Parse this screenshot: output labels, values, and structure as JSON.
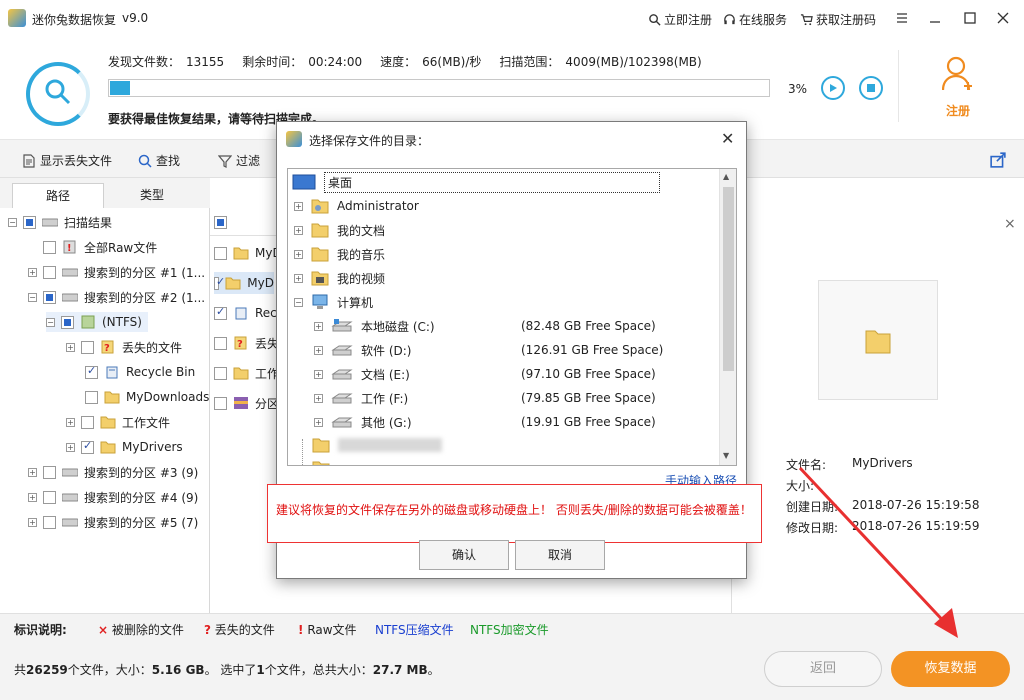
{
  "app": {
    "title": "迷你兔数据恢复",
    "version": "v9.0",
    "links": [
      "立即注册",
      "在线服务",
      "获取注册码"
    ]
  },
  "scan": {
    "found_label": "发现文件数：",
    "found_value": "13155",
    "remaining_label": "剩余时间：",
    "remaining_value": "00:24:00",
    "speed_label": "速度：",
    "speed_value": "66(MB)/秒",
    "range_label": "扫描范围：",
    "range_value": "4009(MB)/102398(MB)",
    "progress_percent": 3,
    "progress_text": "3%",
    "hint": "要获得最佳恢复结果，请等待扫描完成。"
  },
  "register_label": "注册",
  "toolbar": {
    "show_lost": "显示丢失文件",
    "find": "查找",
    "filter": "过滤"
  },
  "tabs": [
    "路径",
    "类型"
  ],
  "tree": [
    {
      "label": "扫描结果"
    },
    {
      "label": "全部Raw文件"
    },
    {
      "label": "搜索到的分区 #1 (1..."
    },
    {
      "label": "搜索到的分区 #2 (1..."
    },
    {
      "label": "(NTFS)"
    },
    {
      "label": "丢失的文件"
    },
    {
      "label": "Recycle Bin"
    },
    {
      "label": "MyDownloads"
    },
    {
      "label": "工作文件"
    },
    {
      "label": "MyDrivers"
    },
    {
      "label": "搜索到的分区 #3 (9)"
    },
    {
      "label": "搜索到的分区 #4 (9)"
    },
    {
      "label": "搜索到的分区 #5 (7)"
    }
  ],
  "filelist": [
    "MyD",
    "MyD",
    "Rec",
    "丢失",
    "工作",
    "分区"
  ],
  "preview": {
    "rows": [
      {
        "k": "文件名:",
        "v": "MyDrivers"
      },
      {
        "k": "大小:",
        "v": ""
      },
      {
        "k": "创建日期:",
        "v": "2018-07-26 15:19:58"
      },
      {
        "k": "修改日期:",
        "v": "2018-07-26 15:19:59"
      }
    ]
  },
  "legend": {
    "title": "标识说明:",
    "items": [
      {
        "mark": "×",
        "label": "被删除的文件",
        "color": "#e02020"
      },
      {
        "mark": "?",
        "label": "丢失的文件",
        "color": "#e02020"
      },
      {
        "mark": "!",
        "label": "Raw文件",
        "color": "#e02020"
      },
      {
        "mark": "",
        "label": "NTFS压缩文件",
        "color": "#1a3fd0"
      },
      {
        "mark": "",
        "label": "NTFS加密文件",
        "color": "#1a9a2a"
      }
    ]
  },
  "status": {
    "p1": "共",
    "count": "26259",
    "p2": "个文件，大小：",
    "size": "5.16 GB",
    "p3": "。 选中了",
    "sel": "1",
    "p4": "个文件，总共大小：",
    "sel_size": "27.7 MB",
    "p5": "。"
  },
  "buttons": {
    "back": "返回",
    "recover": "恢复数据"
  },
  "dialog": {
    "title": "选择保存文件的目录：",
    "items": [
      {
        "label": "桌面",
        "free": ""
      },
      {
        "label": "Administrator",
        "free": ""
      },
      {
        "label": "我的文档",
        "free": ""
      },
      {
        "label": "我的音乐",
        "free": ""
      },
      {
        "label": "我的视频",
        "free": ""
      },
      {
        "label": "计算机",
        "free": ""
      },
      {
        "label": "本地磁盘 (C:)",
        "free": "(82.48 GB Free Space)"
      },
      {
        "label": "软件 (D:)",
        "free": "(126.91 GB Free Space)"
      },
      {
        "label": "文档 (E:)",
        "free": "(97.10 GB Free Space)"
      },
      {
        "label": "工作 (F:)",
        "free": "(79.85 GB Free Space)"
      },
      {
        "label": "其他 (G:)",
        "free": "(19.91 GB Free Space)"
      }
    ],
    "manual_link": "手动输入路径",
    "warning": "建议将恢复的文件保存在另外的磁盘或移动硬盘上！ 否则丢失/删除的数据可能会被覆盖！",
    "ok": "确认",
    "cancel": "取消"
  },
  "colors": {
    "accent": "#2ea8dc",
    "orange": "#f39324",
    "warn": "#e01010"
  }
}
